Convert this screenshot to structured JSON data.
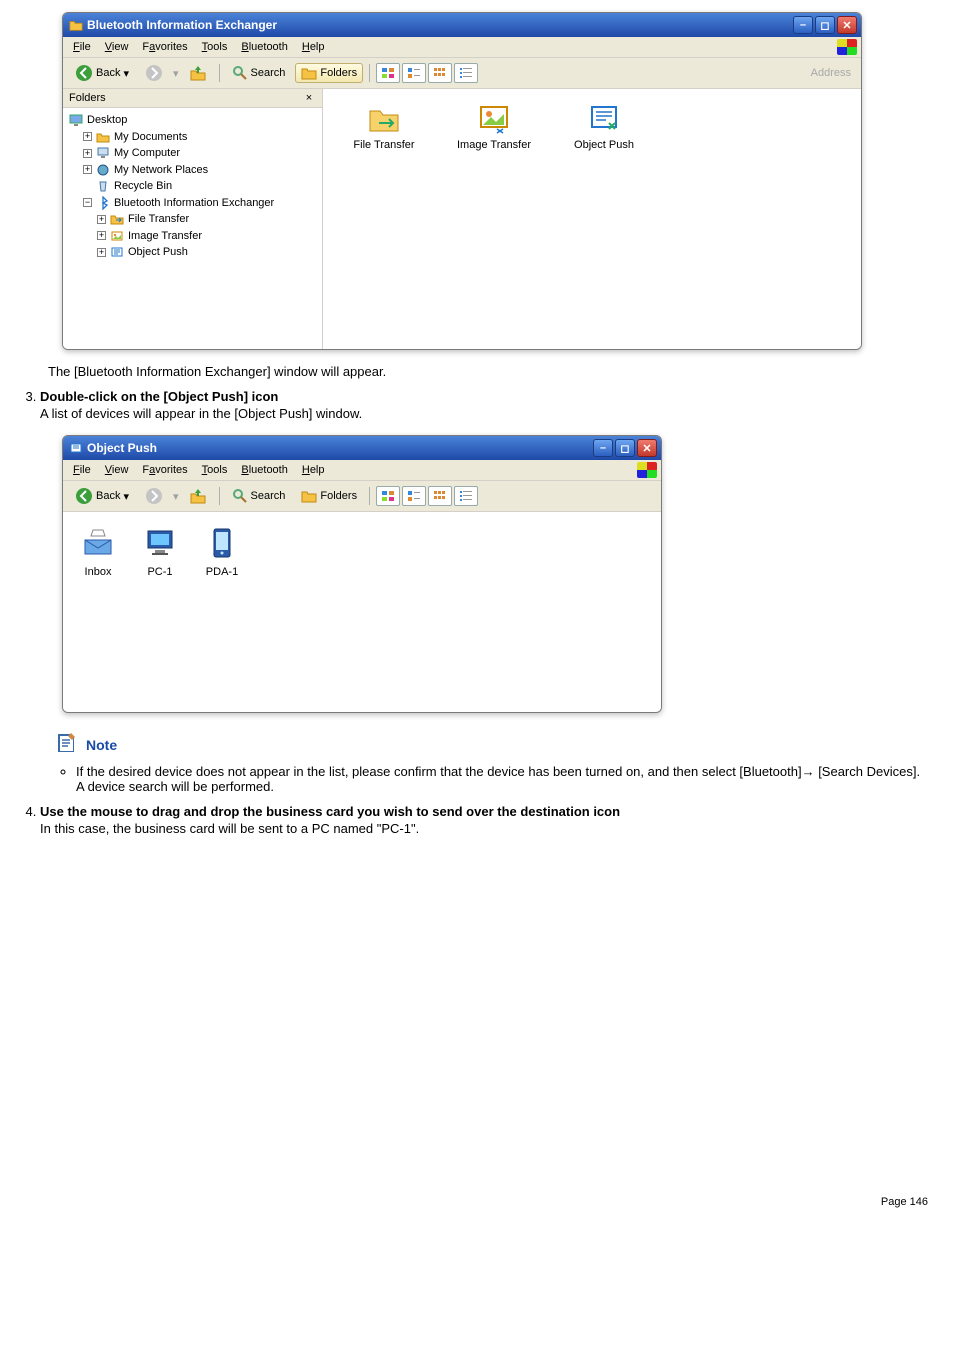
{
  "win1": {
    "title": "Bluetooth Information Exchanger",
    "menus": [
      "File",
      "View",
      "Favorites",
      "Tools",
      "Bluetooth",
      "Help"
    ],
    "toolbar": {
      "back": "Back",
      "search": "Search",
      "folders": "Folders",
      "address": "Address"
    },
    "folders_header": "Folders",
    "tree": {
      "desktop": "Desktop",
      "mydocs": "My Documents",
      "mycomp": "My Computer",
      "mynet": "My Network Places",
      "recycle": "Recycle Bin",
      "bie": "Bluetooth Information Exchanger",
      "ft": "File Transfer",
      "it": "Image Transfer",
      "op": "Object Push"
    },
    "content": {
      "file_transfer": "File Transfer",
      "image_transfer": "Image Transfer",
      "object_push": "Object Push"
    }
  },
  "caption1": "The [Bluetooth Information Exchanger] window will appear.",
  "step3": {
    "num": "3.",
    "head": "Double-click on the [Object Push] icon",
    "sub": "A list of devices will appear in the [Object Push] window."
  },
  "win2": {
    "title": "Object Push",
    "menus": [
      "File",
      "View",
      "Favorites",
      "Tools",
      "Bluetooth",
      "Help"
    ],
    "toolbar": {
      "back": "Back",
      "search": "Search",
      "folders": "Folders"
    },
    "items": {
      "inbox": "Inbox",
      "pc1": "PC-1",
      "pda1": "PDA-1"
    }
  },
  "note": {
    "label": "Note",
    "bullet_a": "If the desired device does not appear in the list, please confirm that the device has been turned on, and then select [Bluetooth]→ [Search Devices].",
    "bullet_b": "A device search will be performed."
  },
  "step4": {
    "num": "4.",
    "head": "Use the mouse to drag and drop the business card you wish to send over the destination icon",
    "sub": "In this case, the business card will be sent to a PC named \"PC-1\"."
  },
  "footer": "Page 146"
}
